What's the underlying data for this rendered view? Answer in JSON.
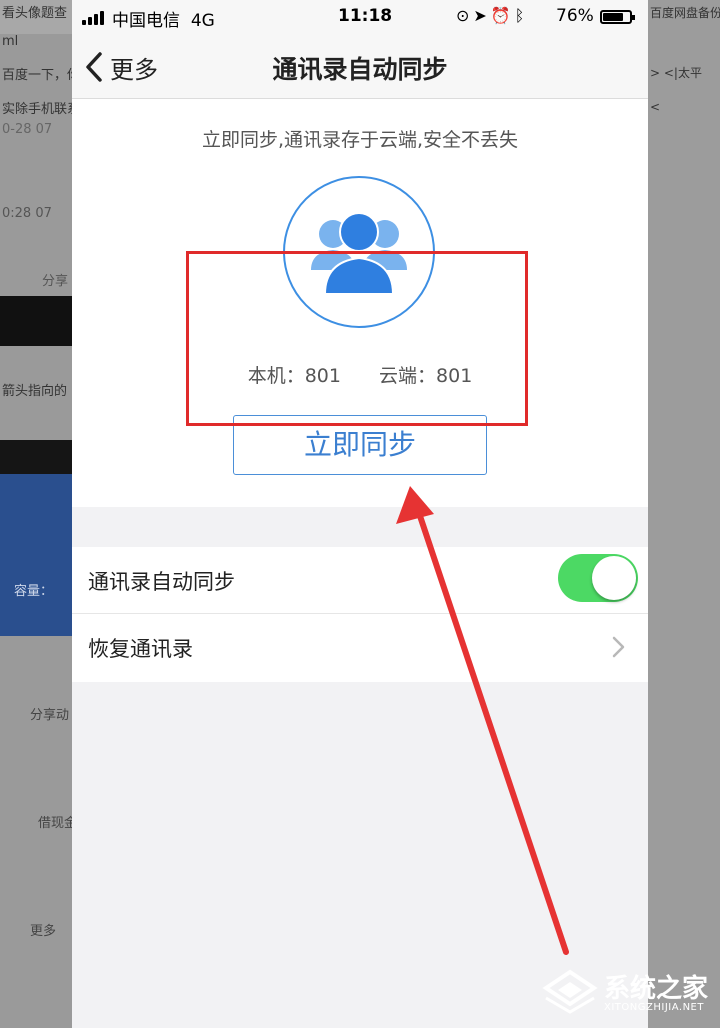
{
  "statusbar": {
    "carrier": "中国电信",
    "network": "4G",
    "time": "11:18",
    "battery": "76%",
    "battery_level": 0.76
  },
  "navbar": {
    "back_label": "更多",
    "title": "通讯录自动同步"
  },
  "sync": {
    "tagline": "立即同步,通讯录存于云端,安全不丢失",
    "local_count": "本机：801",
    "cloud_count": "云端：801",
    "button_label": "立即同步"
  },
  "settings": {
    "auto_sync_label": "通讯录自动同步",
    "auto_sync_on": true,
    "restore_label": "恢复通讯录"
  },
  "background": {
    "left_texts": [
      "看头像题查",
      "ml",
      "百度一下，你",
      "实除手机联系",
      "0-28 07",
      "0:28 07",
      "分享",
      "箭头指向的",
      "容量：",
      "分享动",
      "借现金",
      "更多"
    ],
    "right_texts": [
      "百度网盘备份",
      ">  <|太平",
      "<"
    ]
  },
  "watermark": {
    "title": "系统之家",
    "url": "XITONGZHIJIA.NET"
  },
  "colors": {
    "accent_blue": "#3b7fd0",
    "toggle_green": "#4cd964",
    "annotation_red": "#e02a2a"
  }
}
